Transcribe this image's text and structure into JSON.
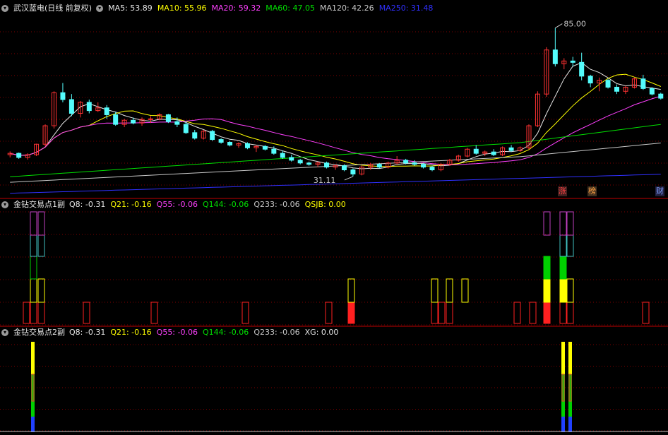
{
  "panel_main": {
    "title": "武汉蓝电(日线 前复权)",
    "ma": [
      {
        "label": "MA5:",
        "value": "53.89",
        "color": "#e6e6e6"
      },
      {
        "label": "MA10:",
        "value": "55.96",
        "color": "#ffff00"
      },
      {
        "label": "MA20:",
        "value": "59.32",
        "color": "#ff40ff"
      },
      {
        "label": "MA60:",
        "value": "47.05",
        "color": "#00e000"
      },
      {
        "label": "MA120:",
        "value": "42.26",
        "color": "#c8c8c8"
      },
      {
        "label": "MA250:",
        "value": "31.48",
        "color": "#3030ff"
      }
    ],
    "high_label": "85.00",
    "low_label": "31.11",
    "badges": [
      {
        "text": "涨",
        "color": "#ff4040",
        "bg": "#402020"
      },
      {
        "text": "榜",
        "color": "#ffa040",
        "bg": "#403020"
      },
      {
        "text": "财",
        "color": "#80a0ff",
        "bg": "#202040"
      }
    ]
  },
  "panel_sub1": {
    "title": "金钻交易点1副",
    "fields": [
      {
        "label": "Q8:",
        "value": "-0.31",
        "color": "#e6e6e6"
      },
      {
        "label": "Q21:",
        "value": "-0.16",
        "color": "#ffff00"
      },
      {
        "label": "Q55:",
        "value": "-0.06",
        "color": "#ff40ff"
      },
      {
        "label": "Q144:",
        "value": "-0.06",
        "color": "#00e000"
      },
      {
        "label": "Q233:",
        "value": "-0.06",
        "color": "#c8c8c8"
      },
      {
        "label": "QSJB:",
        "value": "0.00",
        "color": "#ffff00"
      }
    ]
  },
  "panel_sub2": {
    "title": "金钻交易点2副",
    "fields": [
      {
        "label": "Q8:",
        "value": "-0.31",
        "color": "#e6e6e6"
      },
      {
        "label": "Q21:",
        "value": "-0.16",
        "color": "#ffff00"
      },
      {
        "label": "Q55:",
        "value": "-0.06",
        "color": "#ff40ff"
      },
      {
        "label": "Q144:",
        "value": "-0.06",
        "color": "#00e000"
      },
      {
        "label": "Q233:",
        "value": "-0.06",
        "color": "#c8c8c8"
      },
      {
        "label": "XG:",
        "value": "0.00",
        "color": "#e6e6e6"
      }
    ]
  },
  "colors": {
    "up": "#ff3232",
    "down": "#54fcfc",
    "grid": "#800000",
    "ma5": "#e6e6e6",
    "ma10": "#ffff00",
    "ma20": "#ff40ff",
    "ma60": "#00e000",
    "ma120": "#c8c8c8",
    "ma250": "#3030ff"
  },
  "chart_data": {
    "type": "candlestick",
    "y_range": [
      28,
      90
    ],
    "candles": [
      [
        39.0,
        40.2,
        38.0,
        39.5
      ],
      [
        39.5,
        39.8,
        37.5,
        38.0
      ],
      [
        38.0,
        39.5,
        37.2,
        39.0
      ],
      [
        39.0,
        43.0,
        38.5,
        42.8
      ],
      [
        42.8,
        50.0,
        42.0,
        49.5
      ],
      [
        49.5,
        62.0,
        48.5,
        61.5
      ],
      [
        61.5,
        65.0,
        58.0,
        59.0
      ],
      [
        59.0,
        61.0,
        53.0,
        54.0
      ],
      [
        54.0,
        58.5,
        52.5,
        58.0
      ],
      [
        58.0,
        59.0,
        54.0,
        55.0
      ],
      [
        55.0,
        58.0,
        54.5,
        56.0
      ],
      [
        56.0,
        57.0,
        52.0,
        53.5
      ],
      [
        53.5,
        54.5,
        49.5,
        50.0
      ],
      [
        50.0,
        52.0,
        49.0,
        51.5
      ],
      [
        51.5,
        52.5,
        50.0,
        50.5
      ],
      [
        50.5,
        52.5,
        49.5,
        51.8
      ],
      [
        51.8,
        53.0,
        50.5,
        52.0
      ],
      [
        52.0,
        54.0,
        51.5,
        53.5
      ],
      [
        53.5,
        53.8,
        50.5,
        51.0
      ],
      [
        51.0,
        52.5,
        49.0,
        50.0
      ],
      [
        50.0,
        51.0,
        46.5,
        47.0
      ],
      [
        47.0,
        48.0,
        44.5,
        45.0
      ],
      [
        45.0,
        48.0,
        44.5,
        47.5
      ],
      [
        47.5,
        48.0,
        44.0,
        44.5
      ],
      [
        44.5,
        45.0,
        43.0,
        43.5
      ],
      [
        43.5,
        44.0,
        42.0,
        42.5
      ],
      [
        42.5,
        43.5,
        41.5,
        43.0
      ],
      [
        43.0,
        43.5,
        41.0,
        41.5
      ],
      [
        41.5,
        42.5,
        40.0,
        42.0
      ],
      [
        42.0,
        42.5,
        40.5,
        41.0
      ],
      [
        41.0,
        42.0,
        39.0,
        39.5
      ],
      [
        39.5,
        40.5,
        37.5,
        38.0
      ],
      [
        38.0,
        39.0,
        36.5,
        37.0
      ],
      [
        37.0,
        37.5,
        35.5,
        36.0
      ],
      [
        36.0,
        36.5,
        35.0,
        35.5
      ],
      [
        35.5,
        36.5,
        34.5,
        36.0
      ],
      [
        36.0,
        36.5,
        34.0,
        34.5
      ],
      [
        34.5,
        35.5,
        33.5,
        35.0
      ],
      [
        35.0,
        35.5,
        33.0,
        33.5
      ],
      [
        33.5,
        34.0,
        31.1,
        32.0
      ],
      [
        32.0,
        35.0,
        31.5,
        34.5
      ],
      [
        34.5,
        36.0,
        33.5,
        35.5
      ],
      [
        35.5,
        36.0,
        34.0,
        34.5
      ],
      [
        34.5,
        36.5,
        34.0,
        36.0
      ],
      [
        36.0,
        38.5,
        35.5,
        37.0
      ],
      [
        37.0,
        37.5,
        35.5,
        36.0
      ],
      [
        36.0,
        37.0,
        35.0,
        35.5
      ],
      [
        35.5,
        36.0,
        34.0,
        34.5
      ],
      [
        34.5,
        35.0,
        33.0,
        33.5
      ],
      [
        33.5,
        36.0,
        33.0,
        35.5
      ],
      [
        35.5,
        37.5,
        35.0,
        37.0
      ],
      [
        37.0,
        39.0,
        36.5,
        38.5
      ],
      [
        38.5,
        41.5,
        38.0,
        41.0
      ],
      [
        41.0,
        42.5,
        39.0,
        39.5
      ],
      [
        39.5,
        40.5,
        38.5,
        40.0
      ],
      [
        40.0,
        41.0,
        38.5,
        39.0
      ],
      [
        39.0,
        42.0,
        38.5,
        41.5
      ],
      [
        41.5,
        42.5,
        40.0,
        40.5
      ],
      [
        40.5,
        42.0,
        40.0,
        41.5
      ],
      [
        41.5,
        50.0,
        41.0,
        49.5
      ],
      [
        49.5,
        62.0,
        49.0,
        61.0
      ],
      [
        61.0,
        78.0,
        60.0,
        77.0
      ],
      [
        77.0,
        85.0,
        71.0,
        72.0
      ],
      [
        72.0,
        74.0,
        70.0,
        73.0
      ],
      [
        73.0,
        74.5,
        71.0,
        72.5
      ],
      [
        72.5,
        76.0,
        66.0,
        67.5
      ],
      [
        67.5,
        68.0,
        63.5,
        65.0
      ],
      [
        65.0,
        67.0,
        62.0,
        66.0
      ],
      [
        66.0,
        66.5,
        63.0,
        63.5
      ],
      [
        63.5,
        64.5,
        61.0,
        62.0
      ],
      [
        62.0,
        64.0,
        61.0,
        63.5
      ],
      [
        63.5,
        67.0,
        63.0,
        66.5
      ],
      [
        66.5,
        68.0,
        62.5,
        63.0
      ],
      [
        63.0,
        63.5,
        60.5,
        61.0
      ],
      [
        61.0,
        61.5,
        59.0,
        59.5
      ]
    ]
  }
}
